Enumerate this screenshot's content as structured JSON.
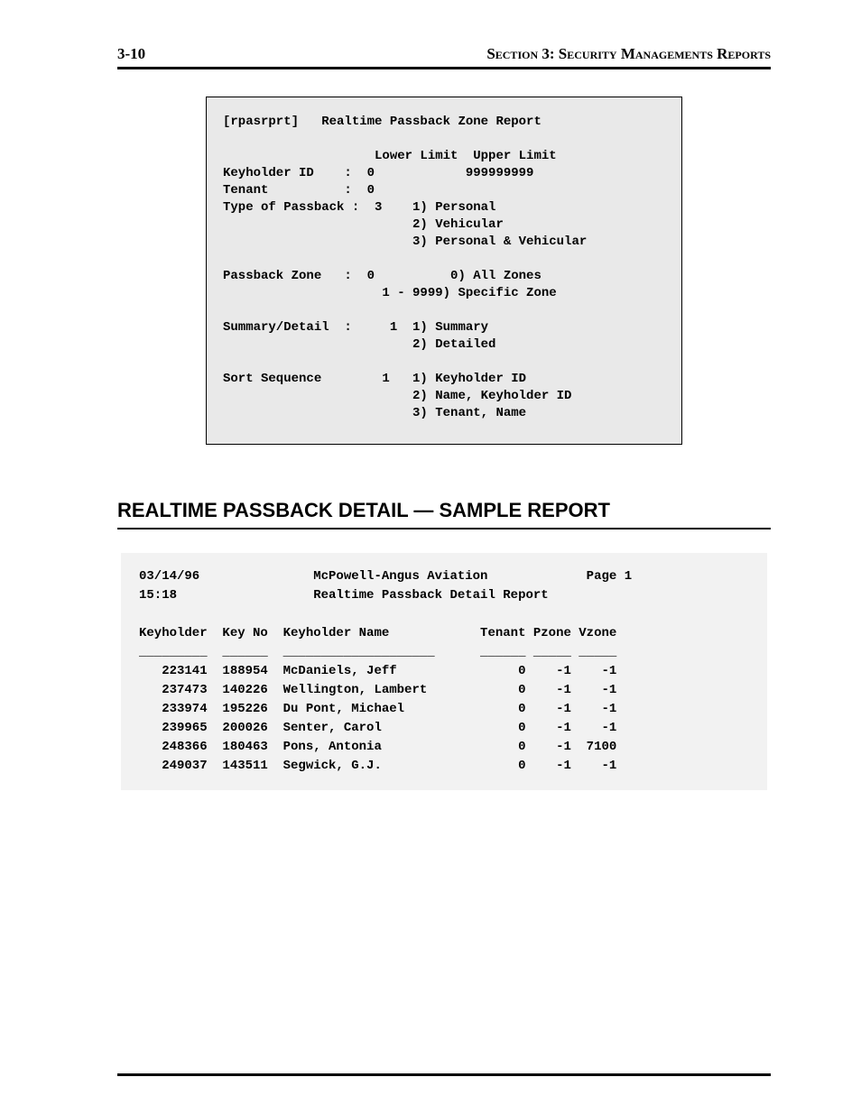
{
  "header": {
    "page_no": "3-10",
    "section_label": "Section 3: Security Managements Reports"
  },
  "terminal": {
    "title_line": "[rpasrprt]   Realtime Passback Zone Report",
    "cols_header": "                    Lower Limit  Upper Limit",
    "keyholder_line": "Keyholder ID    :  0            999999999",
    "tenant_line": "Tenant          :  0",
    "type_lines": [
      "Type of Passback :  3    1) Personal",
      "                         2) Vehicular",
      "                         3) Personal & Vehicular"
    ],
    "passback_lines": [
      "Passback Zone   :  0          0) All Zones",
      "                     1 - 9999) Specific Zone"
    ],
    "summary_lines": [
      "Summary/Detail  :     1  1) Summary",
      "                         2) Detailed"
    ],
    "sort_lines": [
      "Sort Sequence        1   1) Keyholder ID",
      "                         2) Name, Keyholder ID",
      "                         3) Tenant, Name"
    ]
  },
  "section_heading": "REALTIME PASSBACK DETAIL — SAMPLE REPORT",
  "report": {
    "hdr1": "03/14/96               McPowell-Angus Aviation             Page 1",
    "hdr2": "15:18                  Realtime Passback Detail Report",
    "col_hdr": "Keyholder  Key No  Keyholder Name            Tenant Pzone Vzone",
    "rule_line": "_________  ______  ____________________      ______ _____ _____",
    "rows": [
      {
        "keyholder": "223141",
        "keyno": "188954",
        "name": "McDaniels, Jeff",
        "tenant": "0",
        "pzone": "-1",
        "vzone": "-1"
      },
      {
        "keyholder": "237473",
        "keyno": "140226",
        "name": "Wellington, Lambert",
        "tenant": "0",
        "pzone": "-1",
        "vzone": "-1"
      },
      {
        "keyholder": "233974",
        "keyno": "195226",
        "name": "Du Pont, Michael",
        "tenant": "0",
        "pzone": "-1",
        "vzone": "-1"
      },
      {
        "keyholder": "239965",
        "keyno": "200026",
        "name": "Senter, Carol",
        "tenant": "0",
        "pzone": "-1",
        "vzone": "-1"
      },
      {
        "keyholder": "248366",
        "keyno": "180463",
        "name": "Pons, Antonia",
        "tenant": "0",
        "pzone": "-1",
        "vzone": "7100"
      },
      {
        "keyholder": "249037",
        "keyno": "143511",
        "name": "Segwick, G.J.",
        "tenant": "0",
        "pzone": "-1",
        "vzone": "-1"
      }
    ]
  }
}
